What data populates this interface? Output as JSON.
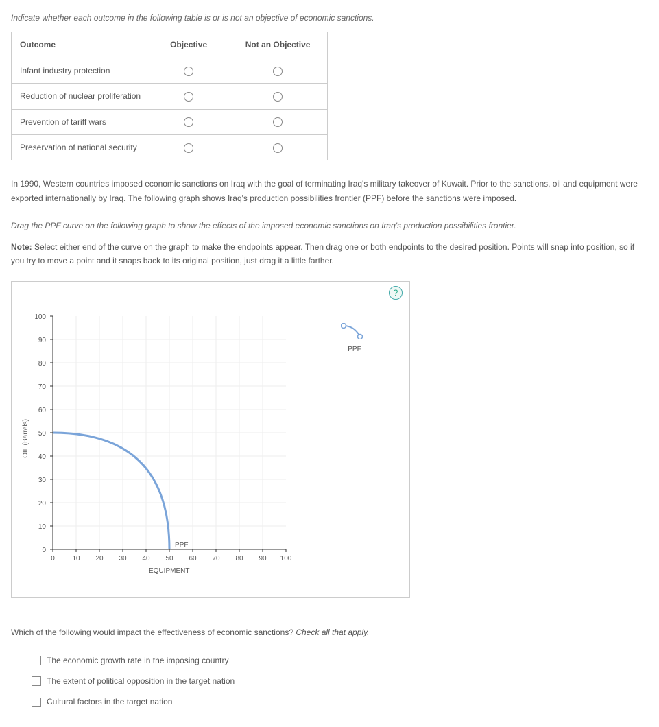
{
  "intro1": "Indicate whether each outcome in the following table is or is not an objective of economic sanctions.",
  "table": {
    "headers": [
      "Outcome",
      "Objective",
      "Not an Objective"
    ],
    "rows": [
      "Infant industry protection",
      "Reduction of nuclear proliferation",
      "Prevention of tariff wars",
      "Preservation of national security"
    ]
  },
  "para1": "In 1990, Western countries imposed economic sanctions on Iraq with the goal of terminating Iraq's military takeover of Kuwait. Prior to the sanctions, oil and equipment were exported internationally by Iraq. The following graph shows Iraq's production possibilities frontier (PPF) before the sanctions were imposed.",
  "instruction2": "Drag the PPF curve on the following graph to show the effects of the imposed economic sanctions on Iraq's production possibilities frontier.",
  "noteLabel": "Note:",
  "noteText": " Select either end of the curve on the graph to make the endpoints appear. Then drag one or both endpoints to the desired position. Points will snap into position, so if you try to move a point and it snaps back to its original position, just drag it a little farther.",
  "help": "?",
  "legend": {
    "label": "PPF"
  },
  "chart_data": {
    "type": "line",
    "xlabel": "EQUIPMENT",
    "ylabel": "OIL (Barrels)",
    "xlim": [
      0,
      100
    ],
    "ylim": [
      0,
      100
    ],
    "xticks": [
      0,
      10,
      20,
      30,
      40,
      50,
      60,
      70,
      80,
      90,
      100
    ],
    "yticks": [
      0,
      10,
      20,
      30,
      40,
      50,
      60,
      70,
      80,
      90,
      100
    ],
    "series": [
      {
        "name": "PPF",
        "points": [
          [
            0,
            50
          ],
          [
            10,
            49
          ],
          [
            20,
            48
          ],
          [
            30,
            45
          ],
          [
            40,
            38
          ],
          [
            45,
            30
          ],
          [
            48,
            20
          ],
          [
            49,
            10
          ],
          [
            50,
            0
          ]
        ]
      }
    ],
    "curve_inline_label": "PPF"
  },
  "q2_intro": "Which of the following would impact the effectiveness of economic sanctions? ",
  "q2_hint": "Check all that apply.",
  "options": [
    "The economic growth rate in the imposing country",
    "The extent of political opposition in the target nation",
    "Cultural factors in the target nation"
  ]
}
